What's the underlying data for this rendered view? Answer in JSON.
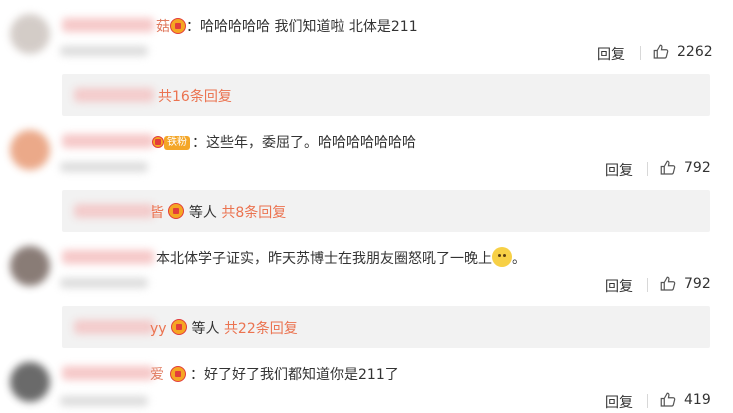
{
  "colors": {
    "accent": "#eb7350",
    "bar_bg": "#f2f2f2",
    "badge": "#f5a623"
  },
  "comments": [
    {
      "name_tail": "菇",
      "text": "：哈哈哈哈哈 我们知道啦 北体是211",
      "reply_label": "回复",
      "likes": "2262",
      "reply_bar": {
        "prefix": "",
        "others": "",
        "count_label": "共16条回复"
      }
    },
    {
      "name_tail": "",
      "fan_badge": "铁粉",
      "text": "：这些年，委屈了。哈哈哈哈哈哈哈",
      "reply_label": "回复",
      "likes": "792",
      "reply_bar": {
        "prefix": "皆",
        "others": "等人",
        "count_label": "共8条回复"
      }
    },
    {
      "name_tail": "",
      "text": "本北体学子证实，昨天苏博士在我朋友圈怒吼了一晚上",
      "text_tail": "。",
      "reply_label": "回复",
      "likes": "792",
      "reply_bar": {
        "prefix": "yy",
        "others": "等人",
        "count_label": "共22条回复"
      }
    },
    {
      "name_tail": "爱",
      "text": "：好了好了我们都知道你是211了",
      "reply_label": "回复",
      "likes": "419"
    }
  ]
}
